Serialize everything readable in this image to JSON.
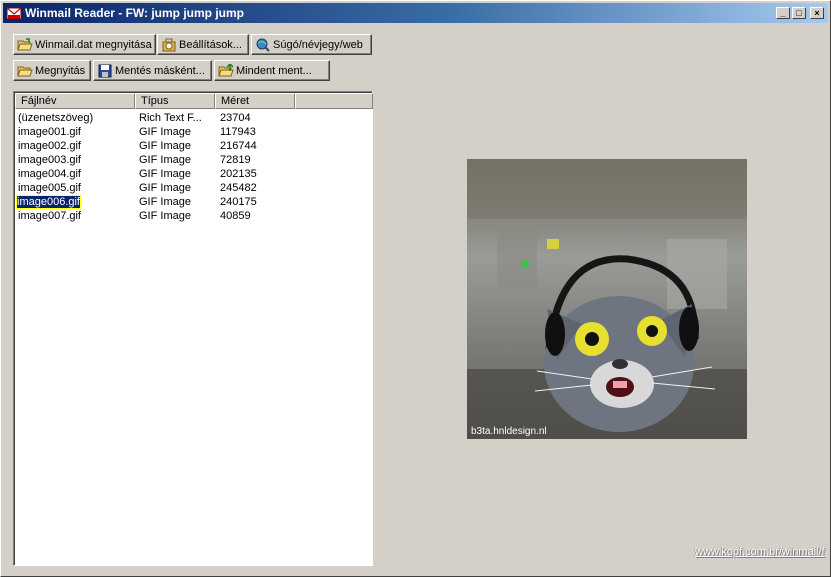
{
  "window": {
    "title": "Winmail Reader - FW: jump jump jump",
    "controls": {
      "minimize": "_",
      "maximize": "□",
      "close": "×"
    }
  },
  "toolbar1": {
    "open_dat": "Winmail.dat megnyitása",
    "settings": "Beállítások...",
    "help": "Súgó/névjegy/web"
  },
  "toolbar2": {
    "open": "Megnyitás",
    "save_as": "Mentés másként...",
    "save_all": "Mindent ment..."
  },
  "table": {
    "columns": [
      "Fájlnév",
      "Típus",
      "Méret"
    ],
    "rows": [
      [
        "(üzenetszöveg)",
        "Rich Text F...",
        "23704"
      ],
      [
        "image001.gif",
        "GIF Image",
        "117943"
      ],
      [
        "image002.gif",
        "GIF Image",
        "216744"
      ],
      [
        "image003.gif",
        "GIF Image",
        "72819"
      ],
      [
        "image004.gif",
        "GIF Image",
        "202135"
      ],
      [
        "image005.gif",
        "GIF Image",
        "245482"
      ],
      [
        "image006.gif",
        "GIF Image",
        "240175"
      ],
      [
        "image007.gif",
        "GIF Image",
        "40859"
      ]
    ],
    "selected_index": 6
  },
  "preview": {
    "credit": "b3ta.hnldesign.nl"
  },
  "footer": {
    "link": "www.kopf.com.br/winmail/f"
  },
  "colors": {
    "selection": "#0a246a",
    "face": "#d4d0c8"
  }
}
